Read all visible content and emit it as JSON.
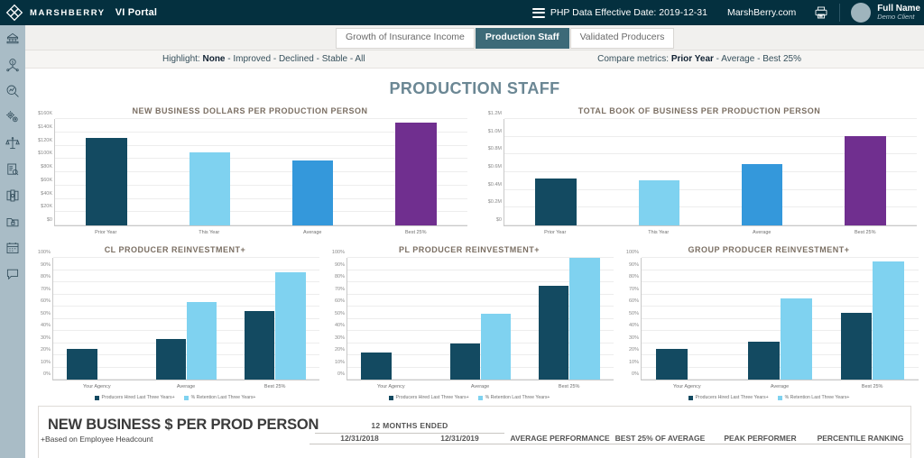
{
  "header": {
    "brand": "MARSHBERRY",
    "portal": "VI Portal",
    "menu_icon": "hamburger-icon",
    "effective_date": "PHP Data Effective Date: 2019-12-31",
    "site_link": "MarshBerry.com",
    "print_icon": "printer-icon",
    "user_name": "Full Name",
    "user_role": "Demo Client"
  },
  "sidebar": {
    "items": [
      {
        "icon": "agency-bank-icon",
        "label": "Agency"
      },
      {
        "icon": "revenue-dollar-icon",
        "label": "Revenue"
      },
      {
        "icon": "magnifier-chart-icon",
        "label": "Analysis"
      },
      {
        "icon": "gears-icon",
        "label": "Operations"
      },
      {
        "icon": "scales-balance-icon",
        "label": "Benchmarks"
      },
      {
        "icon": "document-search-icon",
        "label": "Reports"
      },
      {
        "icon": "presentation-board-icon",
        "label": "Presentation"
      },
      {
        "icon": "folder-lock-icon",
        "label": "Documents"
      },
      {
        "icon": "calendar-icon",
        "label": "Calendar"
      },
      {
        "icon": "chat-bubble-icon",
        "label": "Support"
      }
    ]
  },
  "tabs": [
    {
      "label": "Growth of Insurance Income",
      "active": false
    },
    {
      "label": "Production Staff",
      "active": true
    },
    {
      "label": "Validated Producers",
      "active": false
    }
  ],
  "filters": {
    "highlight_label": "Highlight:",
    "highlight_selected": "None",
    "highlight_rest": " - Improved - Declined - Stable - All",
    "compare_label": "Compare metrics:",
    "compare_selected": "Prior Year",
    "compare_rest": " - Average - Best 25%"
  },
  "page_title": "PRODUCTION STAFF",
  "colors": {
    "header_bg": "#04303f",
    "rail_bg": "#a9bcc6",
    "tab_active": "#3d6a78",
    "title": "#6b8794",
    "dark_teal": "#134a61",
    "light_blue": "#7fd2f0",
    "mid_blue": "#3498db",
    "purple": "#702f8f"
  },
  "chart_data": [
    {
      "id": "new-business-dollars-per-production-person",
      "type": "bar",
      "title": "NEW BUSINESS DOLLARS PER PRODUCTION PERSON",
      "xlabel": "",
      "ylabel": "",
      "categories": [
        "Prior Year",
        "This Year",
        "Average",
        "Best 25%"
      ],
      "values": [
        131000,
        110000,
        97000,
        154000
      ],
      "bar_colors": [
        "#134a61",
        "#7fd2f0",
        "#3498db",
        "#702f8f"
      ],
      "ylim": [
        0,
        160000
      ],
      "yticks": [
        0,
        20000,
        40000,
        60000,
        80000,
        100000,
        120000,
        140000,
        160000
      ],
      "ytick_labels": [
        "$0",
        "$20K",
        "$40K",
        "$60K",
        "$80K",
        "$100K",
        "$120K",
        "$140K",
        "$160K"
      ],
      "grid": true,
      "legend": null
    },
    {
      "id": "total-book-of-business-per-production-person",
      "type": "bar",
      "title": "TOTAL BOOK OF BUSINESS PER PRODUCTION PERSON",
      "xlabel": "",
      "ylabel": "",
      "categories": [
        "Prior Year",
        "This Year",
        "Average",
        "Best 25%"
      ],
      "values": [
        0.53,
        0.51,
        0.69,
        1.01
      ],
      "bar_colors": [
        "#134a61",
        "#7fd2f0",
        "#3498db",
        "#702f8f"
      ],
      "ylim": [
        0,
        1.2
      ],
      "yticks": [
        0,
        0.2,
        0.4,
        0.6,
        0.8,
        1.0,
        1.2
      ],
      "ytick_labels": [
        "$0",
        "$0.2M",
        "$0.4M",
        "$0.6M",
        "$0.8M",
        "$1.0M",
        "$1.2M"
      ],
      "grid": true,
      "legend": null
    },
    {
      "id": "cl-producer-reinvestment",
      "type": "bar",
      "title": "CL PRODUCER REINVESTMENT+",
      "xlabel": "",
      "ylabel": "",
      "categories": [
        "Your Agency",
        "Average",
        "Best 25%"
      ],
      "series": [
        {
          "name": "Producers Hired Last Three Years+",
          "color": "#134a61",
          "values": [
            25,
            33,
            56
          ]
        },
        {
          "name": "% Retention Last Three Years+",
          "color": "#7fd2f0",
          "values": [
            null,
            64,
            88
          ]
        }
      ],
      "ylim": [
        0,
        100
      ],
      "yticks": [
        0,
        10,
        20,
        30,
        40,
        50,
        60,
        70,
        80,
        90,
        100
      ],
      "ytick_labels": [
        "0%",
        "10%",
        "20%",
        "30%",
        "40%",
        "50%",
        "60%",
        "70%",
        "80%",
        "90%",
        "100%"
      ],
      "grid": true,
      "legend": "bottom"
    },
    {
      "id": "pl-producer-reinvestment",
      "type": "bar",
      "title": "PL PRODUCER REINVESTMENT+",
      "xlabel": "",
      "ylabel": "",
      "categories": [
        "Your Agency",
        "Average",
        "Best 25%"
      ],
      "series": [
        {
          "name": "Producers Hired Last Three Years+",
          "color": "#134a61",
          "values": [
            22,
            30,
            77
          ]
        },
        {
          "name": "% Retention Last Three Years+",
          "color": "#7fd2f0",
          "values": [
            null,
            54,
            100
          ]
        }
      ],
      "ylim": [
        0,
        100
      ],
      "yticks": [
        0,
        10,
        20,
        30,
        40,
        50,
        60,
        70,
        80,
        90,
        100
      ],
      "ytick_labels": [
        "0%",
        "10%",
        "20%",
        "30%",
        "40%",
        "50%",
        "60%",
        "70%",
        "80%",
        "90%",
        "100%"
      ],
      "grid": true,
      "legend": "bottom"
    },
    {
      "id": "group-producer-reinvestment",
      "type": "bar",
      "title": "GROUP PRODUCER REINVESTMENT+",
      "xlabel": "",
      "ylabel": "",
      "categories": [
        "Your Agency",
        "Average",
        "Best 25%"
      ],
      "series": [
        {
          "name": "Producers Hired Last Three Years+",
          "color": "#134a61",
          "values": [
            25,
            31,
            55
          ]
        },
        {
          "name": "% Retention Last Three Years+",
          "color": "#7fd2f0",
          "values": [
            null,
            67,
            97
          ]
        }
      ],
      "ylim": [
        0,
        100
      ],
      "yticks": [
        0,
        10,
        20,
        30,
        40,
        50,
        60,
        70,
        80,
        90,
        100
      ],
      "ytick_labels": [
        "0%",
        "10%",
        "20%",
        "30%",
        "40%",
        "50%",
        "60%",
        "70%",
        "80%",
        "90%",
        "100%"
      ],
      "grid": true,
      "legend": "bottom"
    }
  ],
  "table": {
    "section_title": "NEW BUSINESS $ PER PROD PERSON",
    "section_note": "+Based on Employee Headcount",
    "span_header": "12 MONTHS ENDED",
    "columns": [
      "12/31/2018",
      "12/31/2019",
      "AVERAGE PERFORMANCE",
      "BEST 25% OF AVERAGE",
      "PEAK PERFORMER",
      "PERCENTILE RANKING"
    ]
  }
}
